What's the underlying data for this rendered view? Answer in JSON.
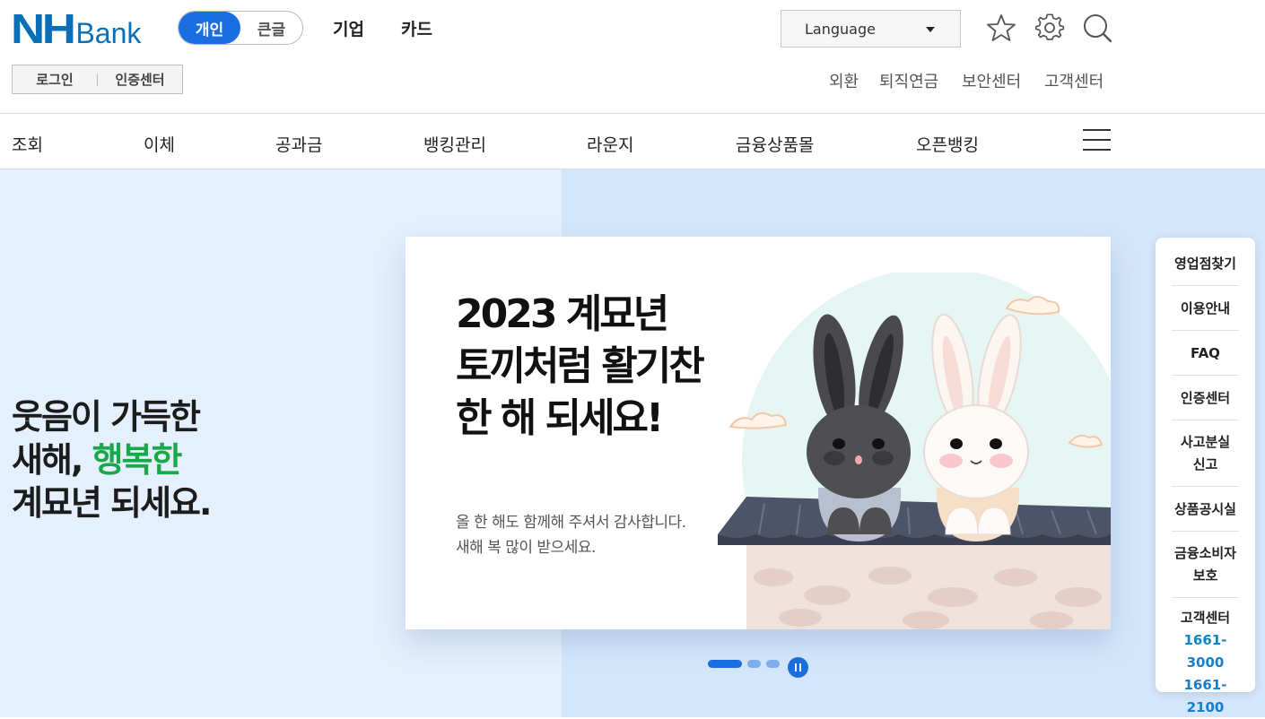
{
  "header": {
    "logo_nh": "NH",
    "logo_bank": "Bank",
    "mode_toggle": {
      "active": "개인",
      "inactive": "큰글"
    },
    "top_links": [
      "기업",
      "카드"
    ],
    "language_label": "Language",
    "auth": {
      "login": "로그인",
      "cert": "인증센터"
    },
    "util_links": [
      "외환",
      "퇴직연금",
      "보안센터",
      "고객센터"
    ]
  },
  "gnb": {
    "items": [
      "조회",
      "이체",
      "공과금",
      "뱅킹관리",
      "라운지",
      "금융상품몰",
      "오픈뱅킹"
    ]
  },
  "hero": {
    "line1": "웃음이 가득한",
    "line2_a": "새해,",
    "line2_b": "행복한",
    "line3": "계묘년 되세요."
  },
  "banner": {
    "title_1": "2023 계묘년",
    "title_2": "토끼처럼 활기찬",
    "title_3": "한 해 되세요!",
    "sub_1": "올 한 해도 함께해 주셔서 감사합니다.",
    "sub_2": "새해 복 많이 받으세요."
  },
  "quick_menu": {
    "items": [
      "영업점찾기",
      "이용안내",
      "FAQ",
      "인증센터"
    ],
    "loss_report": [
      "사고분실",
      "신고"
    ],
    "product_notice": "상품공시실",
    "consumer_protection": [
      "금융소비자",
      "보호"
    ],
    "customer_center": "고객센터",
    "phones": [
      "1661-3000",
      "1661-2100"
    ]
  },
  "colors": {
    "brand": "#0b6fb8",
    "accent": "#1b6ee0",
    "green": "#1aa84a",
    "phone": "#1580c8"
  },
  "icons": [
    "star-icon",
    "gear-icon",
    "search-icon",
    "menu-icon",
    "pause-icon"
  ]
}
